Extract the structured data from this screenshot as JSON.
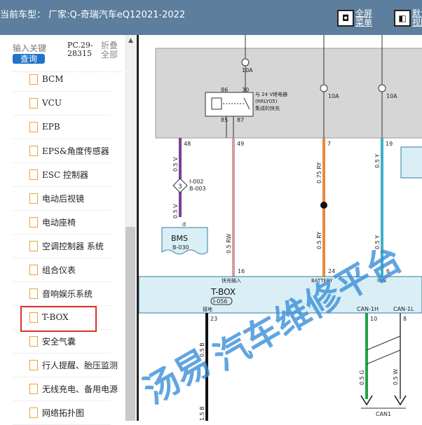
{
  "topbar": {
    "title": "当前车型： 厂家:Q-奇瑞汽车eQ12021-2022",
    "fullscreen_label": "全屏\n菜单",
    "fullscreen_icon": "◘",
    "default_label": "默认\n视图",
    "default_icon": "◧"
  },
  "sidebar": {
    "search_placeholder": "输入关键",
    "search_button": "查询",
    "pc_info": "PC.29-\n28315",
    "collapse_label": "折叠\n全部",
    "items": [
      {
        "label": "BCM"
      },
      {
        "label": "VCU"
      },
      {
        "label": "EPB"
      },
      {
        "label": "EPS&角度传感器"
      },
      {
        "label": "ESC 控制器"
      },
      {
        "label": "电动后视镜"
      },
      {
        "label": "电动座椅"
      },
      {
        "label": "空调控制器 系统"
      },
      {
        "label": "组合仪表"
      },
      {
        "label": "音响娱乐系统"
      },
      {
        "label": "T-BOX"
      },
      {
        "label": "安全气囊"
      },
      {
        "label": "行人提醒、胎压监测"
      },
      {
        "label": "无线充电、备用电源"
      },
      {
        "label": "网络拓扑图"
      }
    ],
    "selected_item": "T-BOX"
  },
  "diagram": {
    "fuse1": "10A",
    "fuse2": "10A",
    "fuse3": "10A",
    "relay_pins": [
      "86",
      "30",
      "85",
      "87"
    ],
    "relay_text": [
      "与 24 V继电器",
      "(RRLY05)",
      "集成的快充"
    ],
    "top_wires": [
      "48",
      "49",
      "7",
      "19"
    ],
    "wire_labels": [
      "0.5 V",
      "0.5 V",
      "0.5 RW",
      "0.75 RY",
      "0.5 RY",
      "0.5 Y",
      "0.5 Y"
    ],
    "connector_num": "3",
    "connector_ids": [
      "I-002",
      "B-003"
    ],
    "bms_name": "BMS",
    "bms_id": "B-030",
    "bms_pin": "d",
    "tbox_pins": [
      "16",
      "24",
      "6"
    ],
    "tbox_signals": [
      "快充输入",
      "BATTERY",
      "IGN"
    ],
    "tbox_name": "T-BOX",
    "tbox_id": "I-056",
    "bottom_pins": [
      "23",
      "10",
      "8"
    ],
    "bottom_signals": [
      "接地",
      "CAN-1H",
      "CAN-1L"
    ],
    "bottom_wire_labels": [
      "0.5 B",
      "0.5 G",
      "0.5 W",
      "1.5 B"
    ],
    "can_label": "CAN1",
    "watermark": "汽车维修平台",
    "watermark_left": "汤易",
    "colors": {
      "purple": "#7e3e97",
      "pink": "#d89a9f",
      "orange": "#e88a3d",
      "green": "#1fa34a",
      "teal": "#3fb0c4"
    }
  }
}
